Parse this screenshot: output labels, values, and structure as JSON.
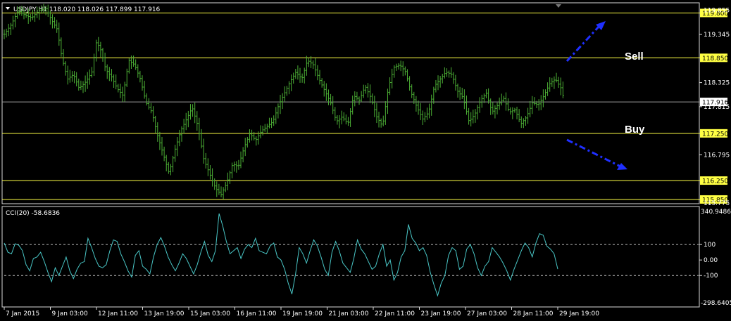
{
  "chart_data": [
    {
      "type": "bar",
      "title": "USDJPY,H1  118.020 118.026 117.899 117.916",
      "symbol": "USDJPY,H1",
      "ohlc": {
        "open": 118.02,
        "high": 118.026,
        "low": 117.899,
        "close": 117.916
      },
      "series_color": "#4caf35",
      "ylim": [
        115.775,
        120.0
      ],
      "y_ticks": [
        "119.345",
        "118.325",
        "117.815",
        "116.795"
      ],
      "y_ticks_partial": [
        "119.855",
        "115.775"
      ],
      "levels": [
        {
          "value": 119.8,
          "label": "119.800",
          "color": "#ffff44"
        },
        {
          "value": 118.85,
          "label": "118.850",
          "color": "#ffff44"
        },
        {
          "value": 117.25,
          "label": "117.250",
          "color": "#ffff44"
        },
        {
          "value": 116.25,
          "label": "116.250",
          "color": "#ffff44"
        },
        {
          "value": 115.85,
          "label": "115.850",
          "color": "#ffff44"
        }
      ],
      "current_price": {
        "value": 117.916,
        "label": "117.916",
        "color": "#9a9a9a"
      },
      "annotations": {
        "sell": "Sell",
        "buy": "Buy",
        "arrow_color": "#1f2fff"
      },
      "x_ticks": [
        "7 Jan 2015",
        "9 Jan 03:00",
        "12 Jan 11:00",
        "13 Jan 19:00",
        "15 Jan 03:00",
        "16 Jan 11:00",
        "19 Jan 19:00",
        "21 Jan 03:00",
        "22 Jan 11:00",
        "23 Jan 19:00",
        "27 Jan 03:00",
        "28 Jan 11:00",
        "29 Jan 19:00"
      ],
      "x_anchors": [
        0,
        4,
        8,
        12,
        16,
        20,
        24,
        28,
        32,
        36,
        40,
        44,
        48
      ],
      "x_anchor_max": 48,
      "close_path": [
        [
          0,
          119.35
        ],
        [
          0.6,
          119.55
        ],
        [
          1.2,
          119.85
        ],
        [
          1.8,
          119.75
        ],
        [
          2.4,
          119.7
        ],
        [
          3.0,
          119.85
        ],
        [
          3.6,
          119.9
        ],
        [
          4.1,
          119.65
        ],
        [
          4.6,
          119.45
        ],
        [
          5.0,
          118.85
        ],
        [
          5.5,
          118.4
        ],
        [
          6.0,
          118.5
        ],
        [
          6.5,
          118.2
        ],
        [
          7.1,
          118.35
        ],
        [
          7.6,
          118.55
        ],
        [
          8.0,
          119.2
        ],
        [
          8.4,
          119.0
        ],
        [
          8.8,
          118.6
        ],
        [
          9.3,
          118.45
        ],
        [
          9.8,
          118.2
        ],
        [
          10.3,
          118.05
        ],
        [
          10.8,
          118.8
        ],
        [
          11.3,
          118.7
        ],
        [
          11.8,
          118.4
        ],
        [
          12.3,
          117.9
        ],
        [
          12.8,
          117.7
        ],
        [
          13.3,
          117.2
        ],
        [
          13.8,
          116.8
        ],
        [
          14.3,
          116.4
        ],
        [
          14.8,
          116.9
        ],
        [
          15.3,
          117.3
        ],
        [
          15.8,
          117.55
        ],
        [
          16.3,
          117.8
        ],
        [
          16.8,
          117.4
        ],
        [
          17.3,
          116.7
        ],
        [
          17.8,
          116.4
        ],
        [
          18.3,
          116.1
        ],
        [
          18.8,
          115.95
        ],
        [
          19.3,
          116.2
        ],
        [
          19.8,
          116.6
        ],
        [
          20.3,
          116.55
        ],
        [
          20.8,
          116.95
        ],
        [
          21.3,
          117.25
        ],
        [
          21.8,
          117.1
        ],
        [
          22.3,
          117.3
        ],
        [
          22.8,
          117.4
        ],
        [
          23.3,
          117.5
        ],
        [
          23.8,
          117.85
        ],
        [
          24.3,
          118.1
        ],
        [
          24.8,
          118.35
        ],
        [
          25.3,
          118.55
        ],
        [
          25.8,
          118.4
        ],
        [
          26.3,
          118.8
        ],
        [
          26.8,
          118.7
        ],
        [
          27.3,
          118.4
        ],
        [
          27.8,
          118.15
        ],
        [
          28.3,
          117.9
        ],
        [
          28.8,
          117.5
        ],
        [
          29.3,
          117.6
        ],
        [
          29.8,
          117.45
        ],
        [
          30.3,
          118.05
        ],
        [
          30.8,
          117.95
        ],
        [
          31.3,
          118.25
        ],
        [
          31.8,
          118.0
        ],
        [
          32.3,
          117.6
        ],
        [
          32.8,
          117.4
        ],
        [
          33.3,
          118.2
        ],
        [
          33.8,
          118.65
        ],
        [
          34.3,
          118.7
        ],
        [
          34.8,
          118.55
        ],
        [
          35.3,
          118.1
        ],
        [
          35.8,
          117.8
        ],
        [
          36.3,
          117.55
        ],
        [
          36.8,
          117.7
        ],
        [
          37.3,
          118.25
        ],
        [
          37.8,
          118.4
        ],
        [
          38.3,
          118.55
        ],
        [
          38.8,
          118.5
        ],
        [
          39.3,
          118.15
        ],
        [
          39.8,
          118.0
        ],
        [
          40.3,
          117.5
        ],
        [
          40.8,
          117.65
        ],
        [
          41.3,
          117.95
        ],
        [
          41.8,
          118.1
        ],
        [
          42.3,
          117.7
        ],
        [
          42.8,
          117.85
        ],
        [
          43.3,
          118.0
        ],
        [
          43.8,
          117.7
        ],
        [
          44.3,
          117.75
        ],
        [
          44.8,
          117.45
        ],
        [
          45.3,
          117.6
        ],
        [
          45.8,
          117.9
        ],
        [
          46.3,
          117.85
        ],
        [
          46.8,
          118.05
        ],
        [
          47.3,
          118.3
        ],
        [
          47.8,
          118.4
        ],
        [
          48.3,
          118.2
        ],
        [
          48.6,
          117.916
        ]
      ]
    },
    {
      "type": "line",
      "title": "CCI(20) -58.6836",
      "indicator": "CCI(20)",
      "current_value": -58.6836,
      "series_color": "#49c6c6",
      "ylim": [
        -298.6405,
        340.9486
      ],
      "y_ticks": [
        "340.9486",
        "100",
        "0.00",
        "-100",
        "-298.6405"
      ],
      "levels": [
        100,
        -100
      ],
      "values": [
        110,
        50,
        40,
        105,
        95,
        60,
        -30,
        -70,
        10,
        20,
        50,
        -10,
        -80,
        -140,
        -50,
        -100,
        -40,
        20,
        -70,
        -120,
        -60,
        -20,
        -10,
        140,
        80,
        10,
        -40,
        -50,
        -30,
        60,
        130,
        120,
        40,
        -10,
        -70,
        -110,
        30,
        60,
        -40,
        -60,
        -90,
        20,
        100,
        145,
        90,
        20,
        -30,
        -70,
        -20,
        40,
        10,
        -40,
        -90,
        -30,
        50,
        120,
        30,
        -10,
        60,
        300,
        220,
        120,
        40,
        60,
        80,
        10,
        70,
        100,
        80,
        140,
        60,
        50,
        40,
        90,
        110,
        20,
        0,
        -60,
        -150,
        -220,
        -90,
        80,
        40,
        -20,
        60,
        130,
        90,
        20,
        -60,
        -100,
        50,
        120,
        60,
        -20,
        -50,
        -80,
        10,
        130,
        70,
        40,
        -10,
        -60,
        -40,
        40,
        100,
        -40,
        0,
        -130,
        -80,
        20,
        60,
        230,
        140,
        110,
        60,
        80,
        30,
        -80,
        -160,
        -230,
        -150,
        -100,
        30,
        80,
        60,
        -60,
        -40,
        70,
        100,
        40,
        -50,
        -100,
        -40,
        -10,
        80,
        50,
        20,
        -20,
        -70,
        -130,
        -60,
        0,
        60,
        110,
        80,
        20,
        110,
        170,
        160,
        90,
        70,
        40,
        -58.68
      ]
    }
  ]
}
